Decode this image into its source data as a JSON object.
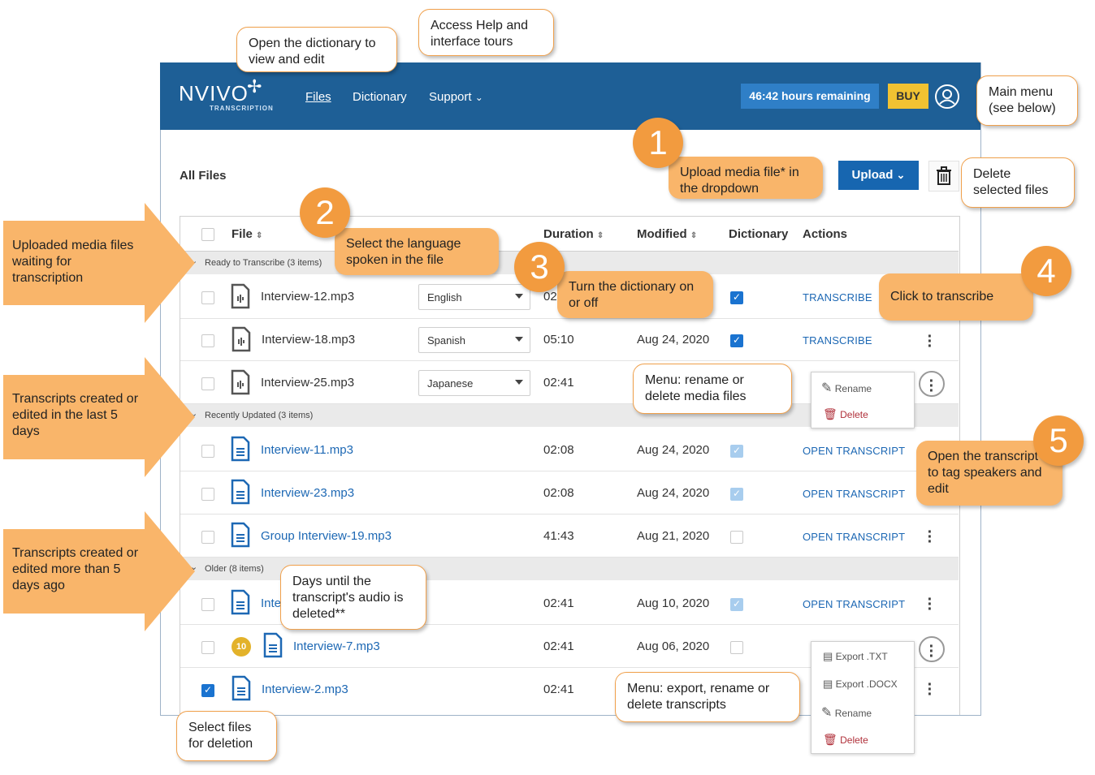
{
  "header": {
    "logo": "NVIVO",
    "logo_sub": "TRANSCRIPTION",
    "nav": [
      "Files",
      "Dictionary",
      "Support"
    ],
    "hours_remaining": "46:42 hours remaining",
    "buy_label": "BUY"
  },
  "toolbar": {
    "title": "All Files",
    "upload_label": "Upload"
  },
  "table": {
    "columns": {
      "file": "File",
      "duration": "Duration",
      "modified": "Modified",
      "dictionary": "Dictionary",
      "actions": "Actions"
    },
    "groups": [
      {
        "label": "Ready to Transcribe (3 items)"
      },
      {
        "label": "Recently Updated (3 items)"
      },
      {
        "label": "Older (8 items)"
      }
    ],
    "rows": [
      {
        "name": "Interview-12.mp3",
        "language": "English",
        "duration": "02:41",
        "modified": "",
        "action": "TRANSCRIBE"
      },
      {
        "name": "Interview-18.mp3",
        "language": "Spanish",
        "duration": "05:10",
        "modified": "Aug 24, 2020",
        "action": "TRANSCRIBE"
      },
      {
        "name": "Interview-25.mp3",
        "language": "Japanese",
        "duration": "02:41",
        "modified": "",
        "action": ""
      },
      {
        "name": "Interview-11.mp3",
        "language": "",
        "duration": "02:08",
        "modified": "Aug 24, 2020",
        "action": "OPEN TRANSCRIPT"
      },
      {
        "name": "Interview-23.mp3",
        "language": "",
        "duration": "02:08",
        "modified": "Aug 24, 2020",
        "action": "OPEN TRANSCRIPT"
      },
      {
        "name": "Group Interview-19.mp3",
        "language": "",
        "duration": "41:43",
        "modified": "Aug 21, 2020",
        "action": "OPEN TRANSCRIPT"
      },
      {
        "name": "Inte",
        "language": "",
        "duration": "02:41",
        "modified": "Aug 10, 2020",
        "action": "OPEN TRANSCRIPT"
      },
      {
        "name": "Interview-7.mp3",
        "language": "",
        "duration": "02:41",
        "modified": "Aug 06, 2020",
        "action": "",
        "days_badge": "10"
      },
      {
        "name": "Interview-2.mp3",
        "language": "",
        "duration": "02:41",
        "modified": "",
        "action": ""
      }
    ]
  },
  "menus": {
    "media": {
      "rename": "Rename",
      "delete": "Delete"
    },
    "transcript": {
      "export_txt": "Export .TXT",
      "export_docx": "Export .DOCX",
      "rename": "Rename",
      "delete": "Delete"
    }
  },
  "callouts": {
    "dictionary": "Open the dictionary to view and edit",
    "support": "Access Help and interface tours",
    "main_menu": "Main menu (see below)",
    "upload": "Upload media file* in the dropdown",
    "delete_files": "Delete selected files",
    "language": "Select the language spoken in the file",
    "dict_toggle": "Turn the dictionary on or off",
    "transcribe": "Click to transcribe",
    "media_menu": "Menu: rename or delete media files",
    "open_transcript": "Open the transcript to tag speakers and edit",
    "days_until": "Days until the transcript's audio is deleted**",
    "transcript_menu": "Menu: export, rename or delete transcripts",
    "select_files": "Select files for deletion",
    "uploaded": "Uploaded media files waiting for transcription",
    "recent": "Transcripts created or edited in the last 5 days",
    "older": "Transcripts created or edited more than 5 days ago"
  },
  "step_numbers": [
    "1",
    "2",
    "3",
    "4",
    "5"
  ],
  "colors": {
    "header": "#1e5f96",
    "accent": "#1766b0",
    "callout": "#f9b56a",
    "buy": "#f1c232"
  }
}
